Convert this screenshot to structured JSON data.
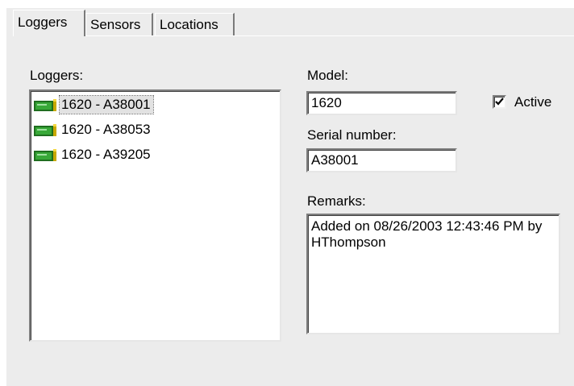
{
  "tabs": [
    {
      "label": "Loggers",
      "active": true
    },
    {
      "label": "Sensors",
      "active": false
    },
    {
      "label": "Locations",
      "active": false
    }
  ],
  "loggers": {
    "label": "Loggers:",
    "items": [
      {
        "text": "1620 - A38001",
        "icon": "logger-device-icon",
        "selected": true
      },
      {
        "text": "1620 - A38053",
        "icon": "logger-device-icon",
        "selected": false
      },
      {
        "text": "1620 - A39205",
        "icon": "logger-device-icon",
        "selected": false
      }
    ]
  },
  "model": {
    "label": "Model:",
    "value": "1620"
  },
  "active": {
    "label": "Active",
    "checked": true
  },
  "serial": {
    "label": "Serial number:",
    "value": "A38001"
  },
  "remarks": {
    "label": "Remarks:",
    "value": "Added on 08/26/2003 12:43:46 PM by HThompson"
  }
}
